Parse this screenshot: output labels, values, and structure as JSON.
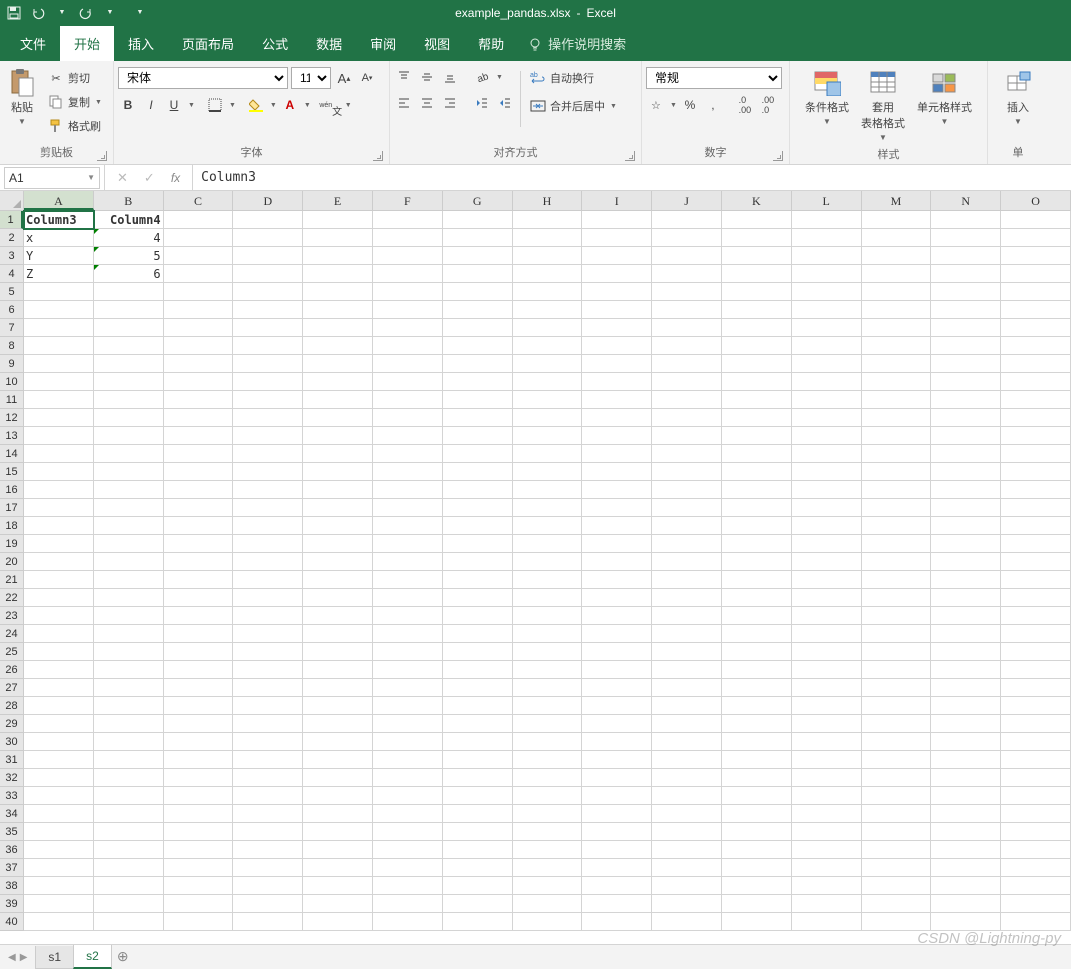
{
  "titlebar": {
    "filename": "example_pandas.xlsx",
    "appname": "Excel"
  },
  "tabs": {
    "file": "文件",
    "home": "开始",
    "insert": "插入",
    "page_layout": "页面布局",
    "formulas": "公式",
    "data": "数据",
    "review": "审阅",
    "view": "视图",
    "help": "帮助",
    "tell_me": "操作说明搜索"
  },
  "ribbon": {
    "clipboard": {
      "label": "剪贴板",
      "paste": "粘贴",
      "cut": "剪切",
      "copy": "复制",
      "format_painter": "格式刷"
    },
    "font": {
      "label": "字体",
      "name": "宋体",
      "size": "11",
      "bold": "B",
      "italic": "I",
      "underline": "U"
    },
    "alignment": {
      "label": "对齐方式",
      "wrap": "自动换行",
      "merge": "合并后居中"
    },
    "number": {
      "label": "数字",
      "format": "常规"
    },
    "styles": {
      "label": "样式",
      "conditional": "条件格式",
      "table": "套用\n表格格式",
      "cell": "单元格样式"
    },
    "cells": {
      "label": "单",
      "insert": "插入"
    }
  },
  "formula_bar": {
    "name_box": "A1",
    "formula": "Column3"
  },
  "columns": [
    "A",
    "B",
    "C",
    "D",
    "E",
    "F",
    "G",
    "H",
    "I",
    "J",
    "K",
    "L",
    "M",
    "N",
    "O"
  ],
  "rows": [
    1,
    2,
    3,
    4,
    5,
    6,
    7,
    8,
    9,
    10,
    11,
    12,
    13,
    14,
    15,
    16,
    17,
    18,
    19,
    20,
    21,
    22,
    23,
    24,
    25,
    26,
    27,
    28,
    29,
    30,
    31,
    32,
    33,
    34,
    35,
    36,
    37,
    38,
    39,
    40
  ],
  "cells": {
    "A1": "Column3",
    "B1": "Column4",
    "A2": "x",
    "B2": "4",
    "A3": "Y",
    "B3": "5",
    "A4": "Z",
    "B4": "6"
  },
  "sheets": {
    "s1": "s1",
    "s2": "s2"
  },
  "watermark": "CSDN @Lightning-py"
}
